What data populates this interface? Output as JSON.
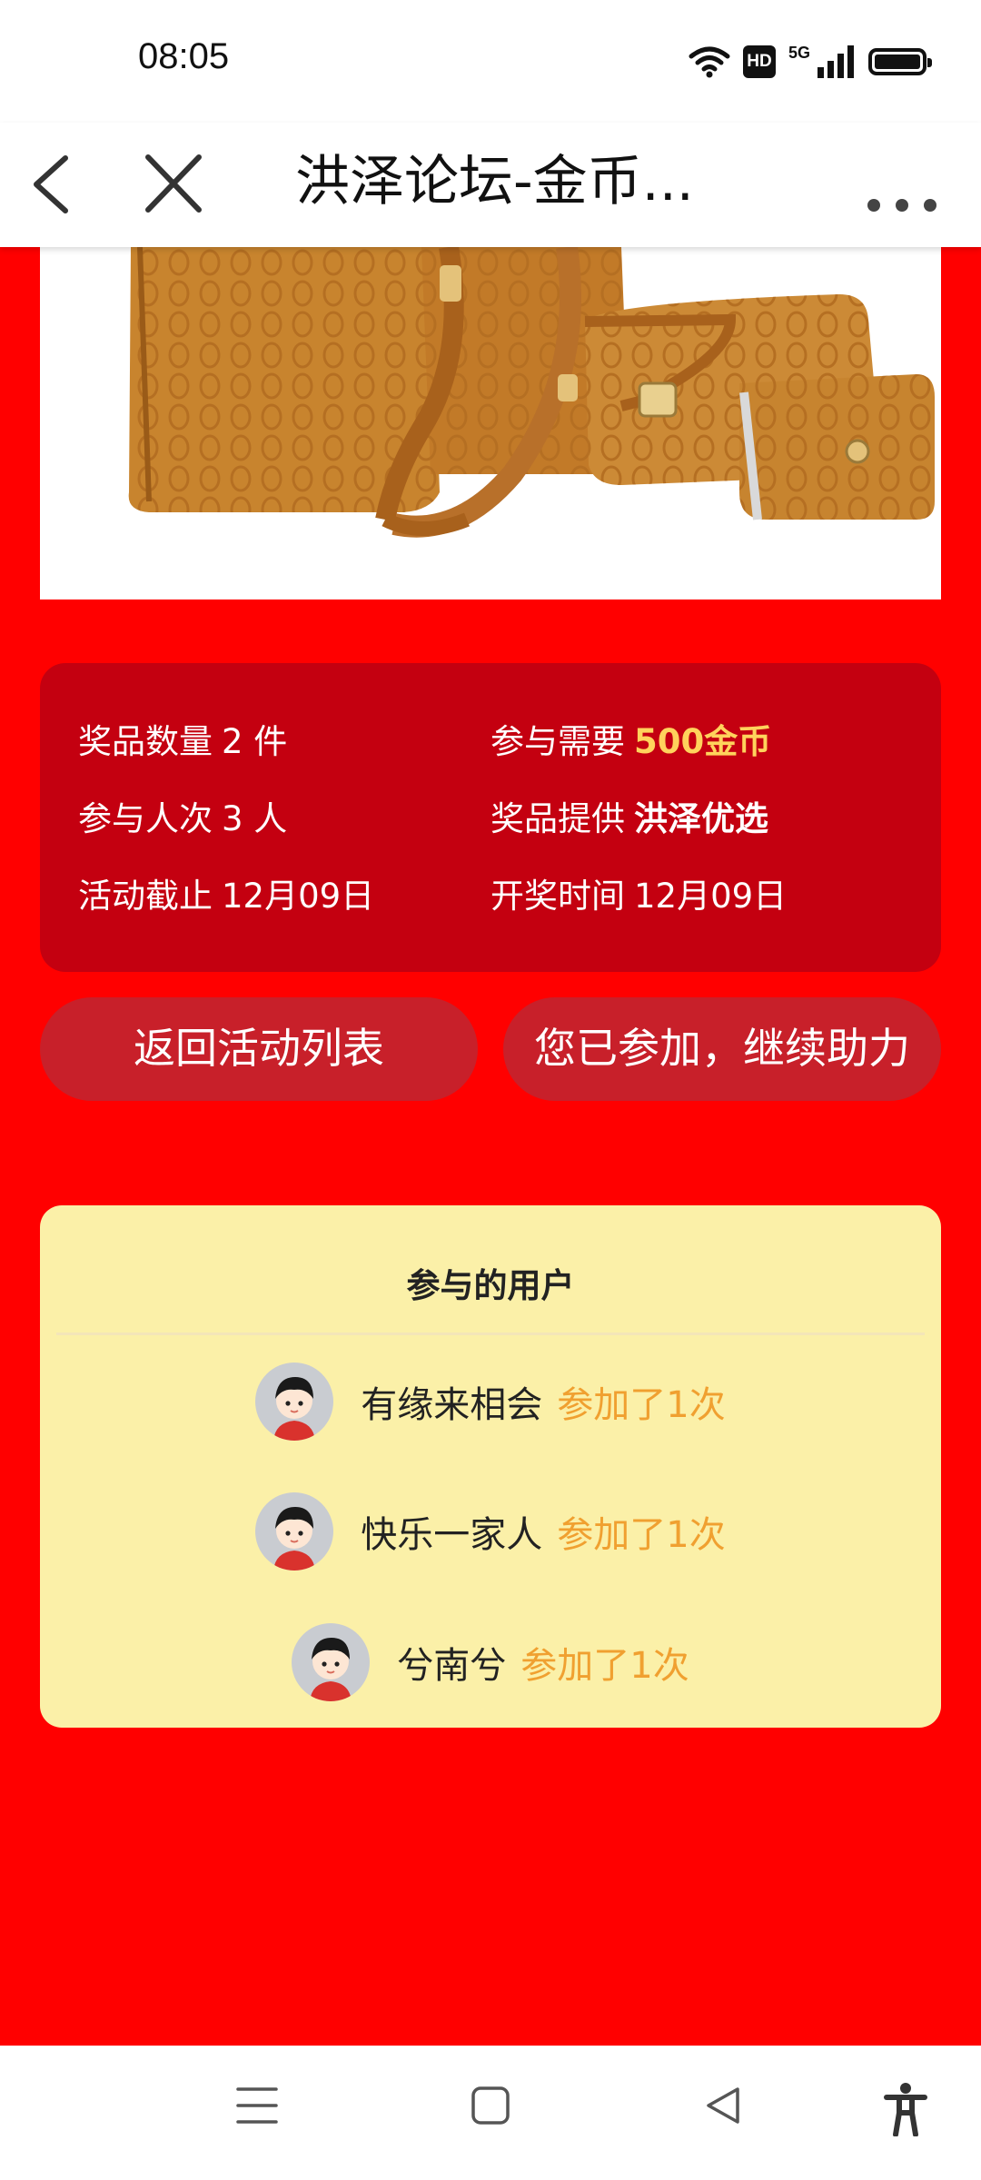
{
  "status_bar": {
    "time": "08:05",
    "hd_badge": "HD",
    "network": "5G",
    "icons": [
      "wifi-icon",
      "hd-icon",
      "signal-icon",
      "battery-icon"
    ]
  },
  "header": {
    "title": "洪泽论坛-金币...",
    "icons": [
      "back-icon",
      "close-icon",
      "more-icon"
    ]
  },
  "prize_info": {
    "quantity_label": "奖品数量",
    "quantity_value": "2 件",
    "cost_label": "参与需要",
    "cost_value": "500金币",
    "participants_label": "参与人次",
    "participants_value": "3 人",
    "provider_label": "奖品提供",
    "provider_value": "洪泽优选",
    "deadline_label": "活动截止",
    "deadline_value": "12月09日",
    "draw_label": "开奖时间",
    "draw_value": "12月09日"
  },
  "buttons": {
    "back_to_list": "返回活动列表",
    "continue_help": "您已参加，继续助力"
  },
  "participants": {
    "title": "参与的用户",
    "users": [
      {
        "name": "有缘来相会",
        "count": "参加了1次"
      },
      {
        "name": "快乐一家人",
        "count": "参加了1次"
      },
      {
        "name": "兮南兮",
        "count": "参加了1次"
      }
    ]
  },
  "colors": {
    "page_background": "#ff0000",
    "info_card": "#c40010",
    "button": "#c8202a",
    "highlight_gold": "#ffd35c",
    "users_card": "#fbf0a8",
    "count_orange": "#f0a030"
  },
  "bottom_nav": {
    "icons": [
      "menu-icon",
      "home-square-icon",
      "back-triangle-icon",
      "accessibility-icon"
    ]
  }
}
